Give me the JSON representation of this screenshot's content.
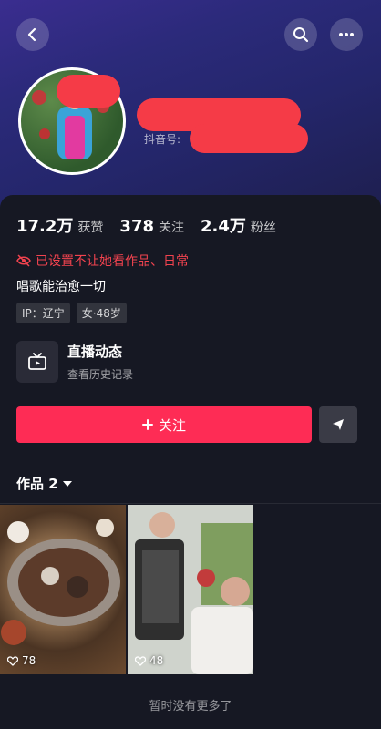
{
  "stats": [
    {
      "value": "17.2万",
      "label": "获赞"
    },
    {
      "value": "378",
      "label": "关注"
    },
    {
      "value": "2.4万",
      "label": "粉丝"
    }
  ],
  "profile": {
    "douyin_id_label": "抖音号:",
    "privacy_notice": "已设置不让她看作品、日常",
    "bio": "唱歌能治愈一切",
    "tags": [
      "IP：辽宁",
      "女·48岁"
    ]
  },
  "live": {
    "title": "直播动态",
    "subtitle": "查看历史记录"
  },
  "actions": {
    "follow_label": "关注",
    "follow_color": "#fe2c55"
  },
  "works": {
    "tab_label": "作品 2",
    "items": [
      {
        "likes": "78",
        "icon": "heart-icon"
      },
      {
        "likes": "48",
        "icon": "heart-icon"
      }
    ],
    "footer": "暂时没有更多了"
  },
  "icons": {
    "back": "chevron-left-icon",
    "search": "search-icon",
    "more": "more-icon",
    "privacy": "eye-off-icon",
    "live": "tv-icon",
    "share": "share-icon"
  }
}
